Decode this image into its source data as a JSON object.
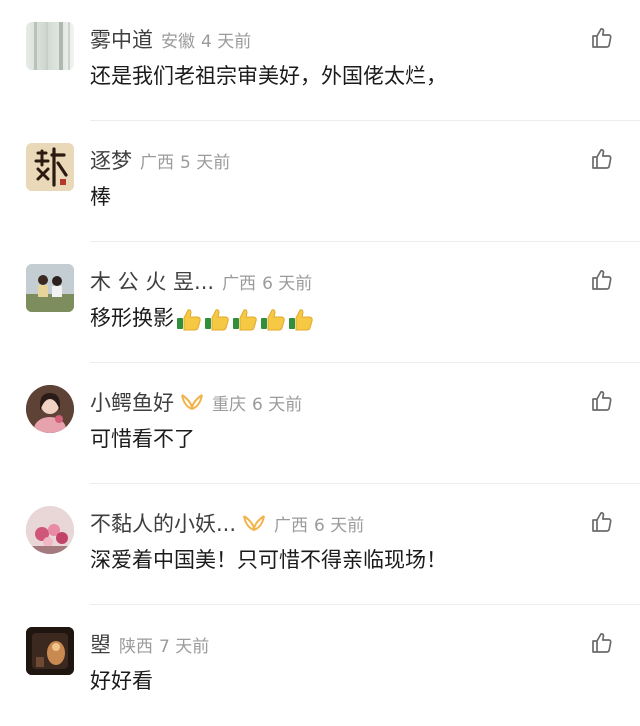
{
  "comments": [
    {
      "name": "雾中道",
      "location": "安徽",
      "time": "4 天前",
      "text": "还是我们老祖宗审美好，外国佬太烂，",
      "avatar_icon": "misty-trees-avatar"
    },
    {
      "name": "逐梦",
      "location": "广西",
      "time": "5 天前",
      "text": "棒",
      "avatar_icon": "calligraphy-avatar"
    },
    {
      "name": "木 公  火 昱...",
      "location": "广西",
      "time": "6 天前",
      "text": "移形换影",
      "emoji": "thumbs-up",
      "emoji_count": 5,
      "avatar_icon": "two-people-avatar"
    },
    {
      "name": "小鳄鱼好",
      "location": "重庆",
      "time": "6 天前",
      "text": "可惜看不了",
      "badge": "vip-badge",
      "avatar_icon": "girl-portrait-avatar"
    },
    {
      "name": "不黏人的小妖...",
      "location": "广西",
      "time": "6 天前",
      "text": "深爱着中国美！只可惜不得亲临现场！",
      "badge": "vip-badge",
      "avatar_icon": "flowers-avatar"
    },
    {
      "name": "曌",
      "location": "陕西",
      "time": "7 天前",
      "text": "好好看",
      "avatar_icon": "dark-figure-avatar"
    }
  ],
  "like_icon": "thumbs-up-outline-icon",
  "colors": {
    "name": "#3f3f3f",
    "meta": "#9b9b9b",
    "text": "#1b1b1b",
    "badge": "#f2b34b",
    "icon": "#6b6b6b"
  }
}
